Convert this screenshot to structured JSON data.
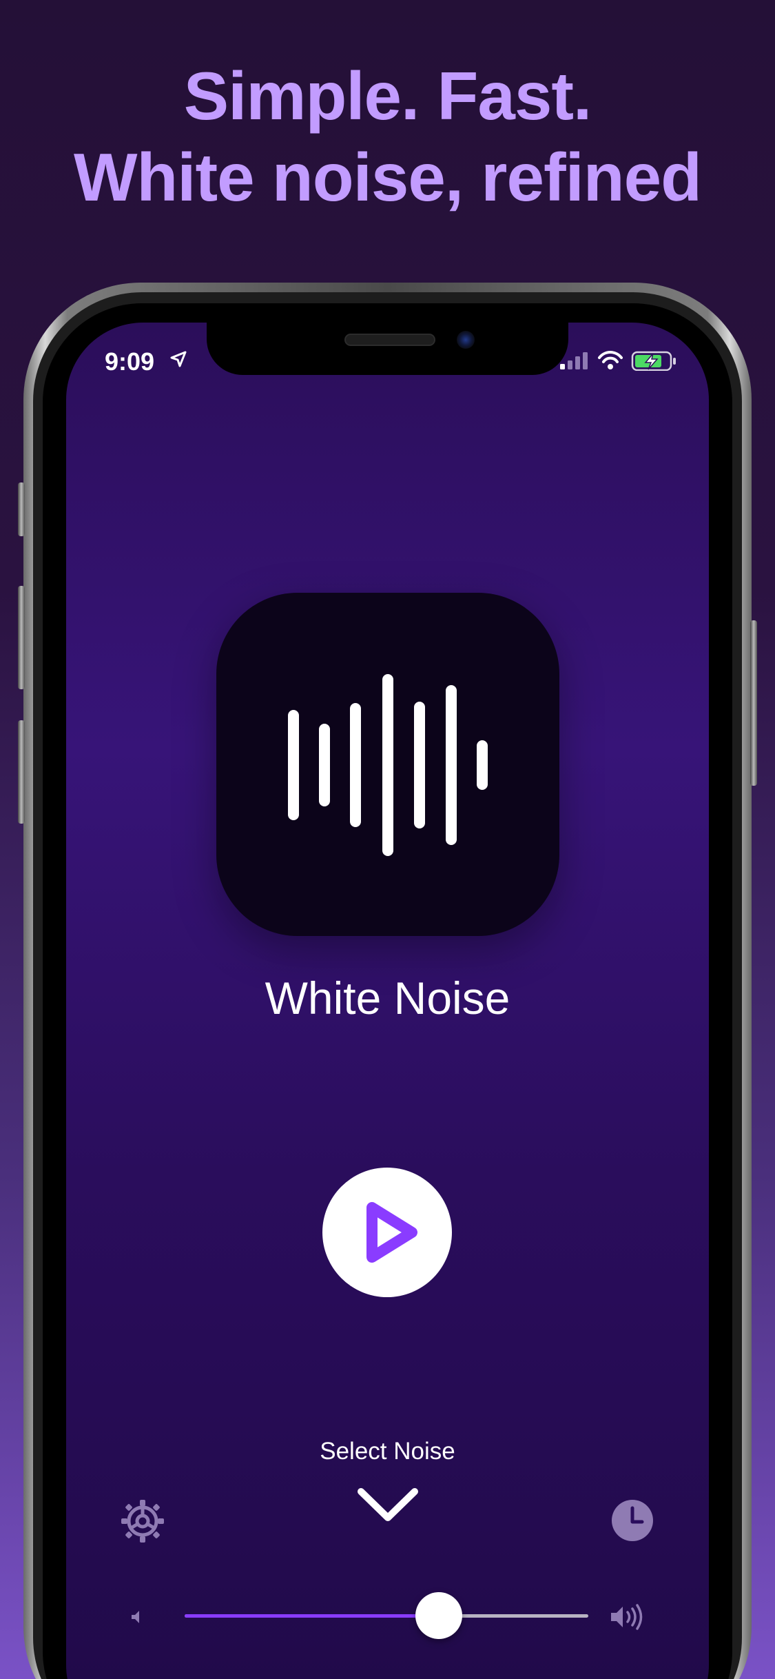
{
  "headline": {
    "line1": "Simple. Fast.",
    "line2": "White noise, refined"
  },
  "status_bar": {
    "time": "9:09",
    "icons": [
      "location-arrow-icon",
      "signal-bars-icon",
      "wifi-icon",
      "battery-charging-icon"
    ]
  },
  "player": {
    "app_icon": "waveform-icon",
    "noise_name": "White Noise",
    "play_icon": "play-icon",
    "select_label": "Select Noise",
    "select_icon": "chevron-down-icon",
    "settings_icon": "gear-icon",
    "timer_icon": "clock-icon"
  },
  "volume": {
    "level": 0.63,
    "low_icon": "volume-low-icon",
    "high_icon": "volume-high-icon"
  },
  "colors": {
    "headline": "#c29cff",
    "accent": "#8a3cff",
    "screen_bg": "#2b0e5a",
    "tile_bg": "#0c041a"
  }
}
